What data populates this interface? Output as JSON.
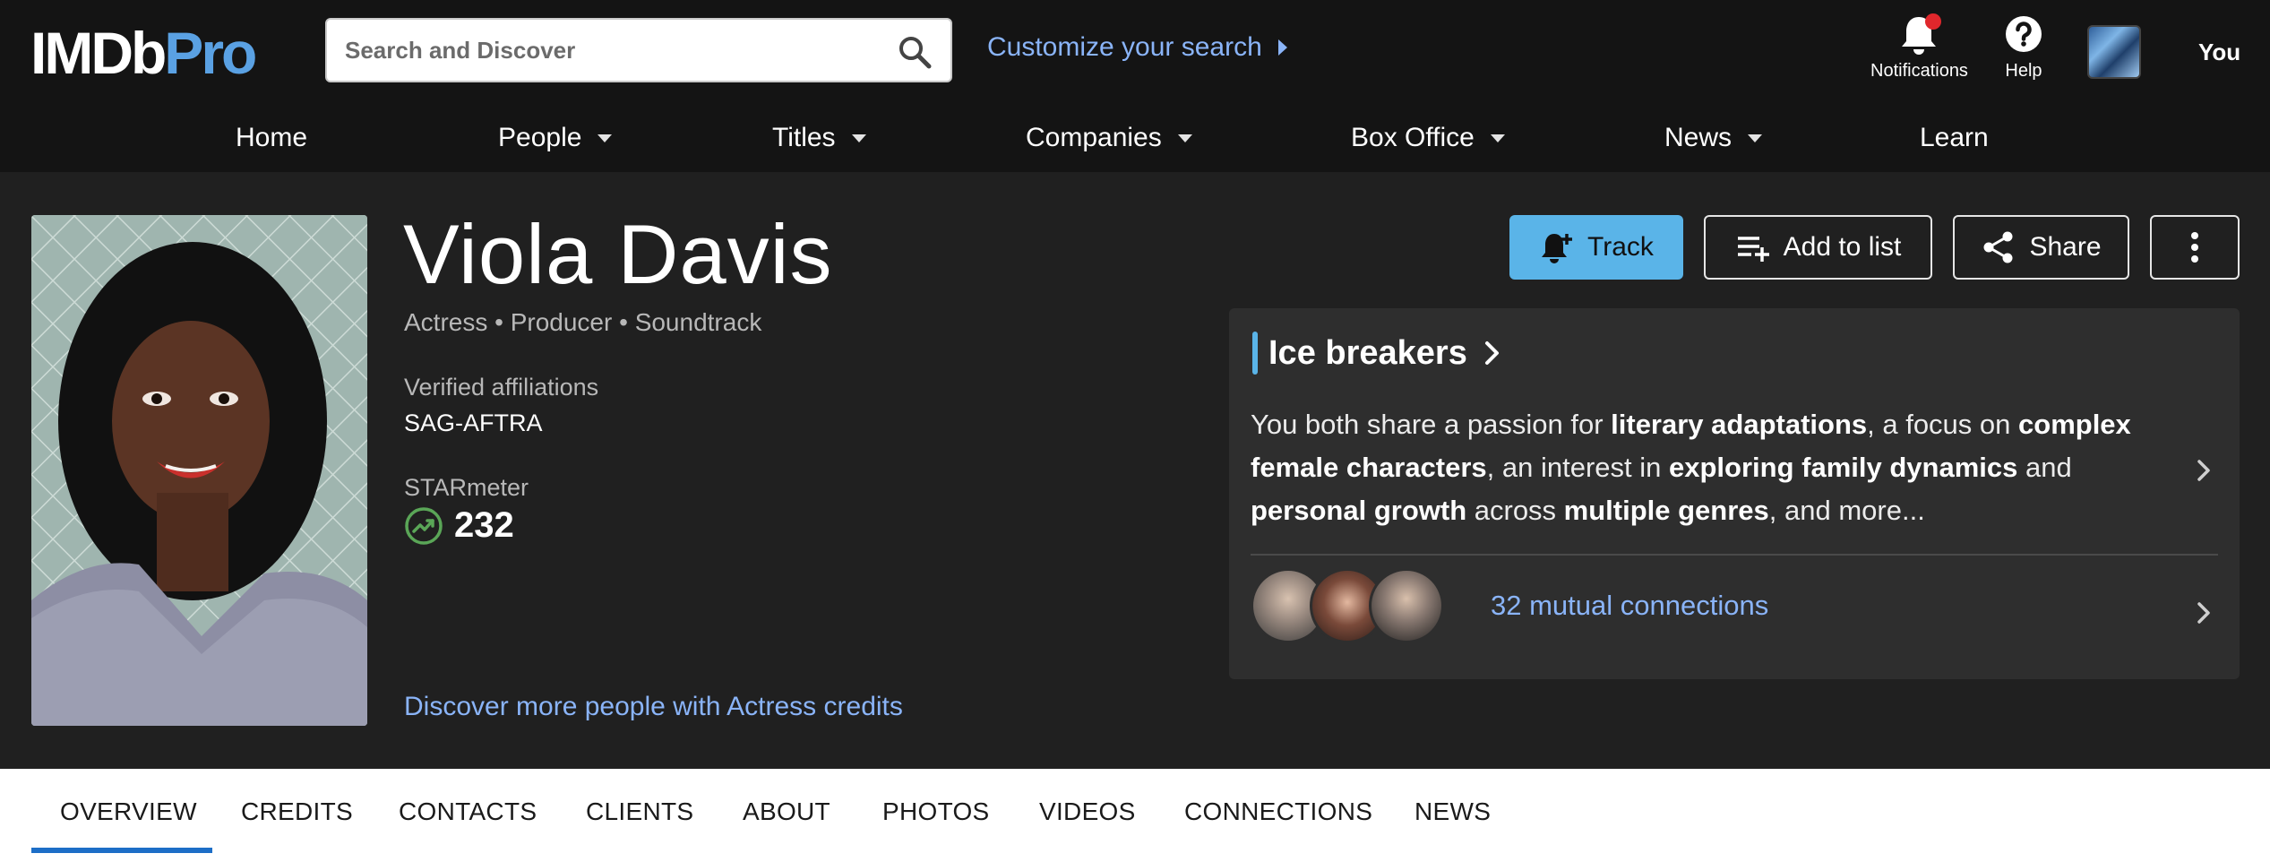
{
  "header": {
    "logo": {
      "imdb": "IMDb",
      "pro": "Pro"
    },
    "search": {
      "placeholder": "Search and Discover",
      "icon": "search-icon"
    },
    "customize_label": "Customize your search",
    "notifications_label": "Notifications",
    "help_label": "Help",
    "user_name": "You"
  },
  "nav": {
    "items": [
      {
        "label": "Home",
        "dropdown": false
      },
      {
        "label": "People",
        "dropdown": true
      },
      {
        "label": "Titles",
        "dropdown": true
      },
      {
        "label": "Companies",
        "dropdown": true
      },
      {
        "label": "Box Office",
        "dropdown": true
      },
      {
        "label": "News",
        "dropdown": true
      },
      {
        "label": "Learn",
        "dropdown": false
      }
    ]
  },
  "profile": {
    "name": "Viola Davis",
    "roles": "Actress • Producer • Soundtrack",
    "affiliations_label": "Verified affiliations",
    "affiliations_value": "SAG-AFTRA",
    "starmeter_label": "STARmeter",
    "starmeter_value": "232",
    "discover_link": "Discover more people with Actress credits"
  },
  "actions": {
    "track": "Track",
    "add_to_list": "Add to list",
    "share": "Share"
  },
  "ice_breakers": {
    "title": "Ice breakers",
    "text_parts": [
      {
        "t": "You both share a passion for ",
        "b": false
      },
      {
        "t": "literary adaptations",
        "b": true
      },
      {
        "t": ", a focus on ",
        "b": false
      },
      {
        "t": "complex female characters",
        "b": true
      },
      {
        "t": ", an interest in ",
        "b": false
      },
      {
        "t": "exploring family dynamics",
        "b": true
      },
      {
        "t": " and ",
        "b": false
      },
      {
        "t": "personal growth",
        "b": true
      },
      {
        "t": " across ",
        "b": false
      },
      {
        "t": "multiple genres",
        "b": true
      },
      {
        "t": ", and more...",
        "b": false
      }
    ],
    "mutual_connections": "32 mutual connections"
  },
  "tabs": [
    "OVERVIEW",
    "CREDITS",
    "CONTACTS",
    "CLIENTS",
    "ABOUT",
    "PHOTOS",
    "VIDEOS",
    "CONNECTIONS",
    "NEWS"
  ],
  "active_tab": "OVERVIEW",
  "colors": {
    "brand_blue": "#5aa1e3",
    "link_blue": "#8ab4f8",
    "track_button": "#5ab4e8",
    "notification_dot": "#e0272c",
    "starmeter_trend": "#5aa657",
    "active_tab_underline": "#1d6ec7"
  }
}
